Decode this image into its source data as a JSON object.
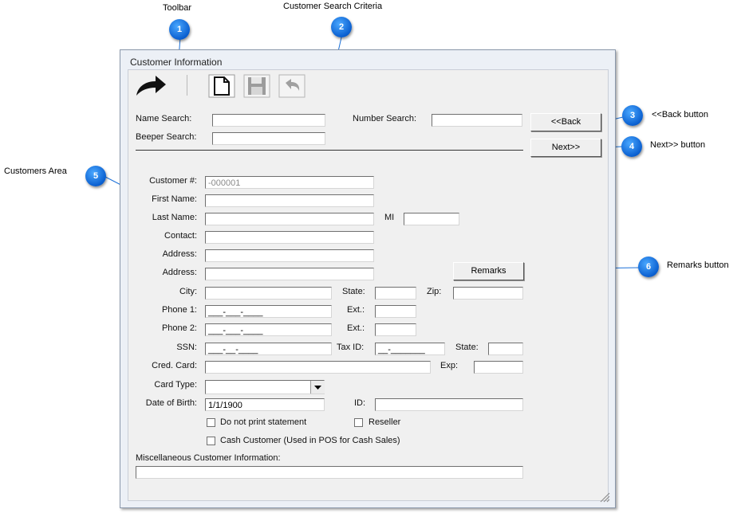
{
  "annotations": {
    "toolbar": "Toolbar",
    "customer_search_criteria": "Customer Search Criteria",
    "back_button": "<<Back button",
    "next_button": "Next>> button",
    "customers_area": "Customers Area",
    "remarks_button": "Remarks button",
    "bubbles": [
      "1",
      "2",
      "3",
      "4",
      "5",
      "6"
    ]
  },
  "window": {
    "title": "Customer Information"
  },
  "toolbar": {
    "icons": [
      "redo-arrow-icon",
      "new-document-icon",
      "save-icon",
      "undo-icon"
    ]
  },
  "search": {
    "name_label": "Name Search:",
    "number_label": "Number Search:",
    "beeper_label": "Beeper Search:",
    "name_value": "",
    "number_value": "",
    "beeper_value": "",
    "back_label": "<<Back",
    "next_label": "Next>>"
  },
  "customer": {
    "customer_no_label": "Customer #:",
    "customer_no_value": "-000001",
    "first_name_label": "First Name:",
    "last_name_label": "Last Name:",
    "mi_label": "MI",
    "contact_label": "Contact:",
    "address1_label": "Address:",
    "address2_label": "Address:",
    "remarks_label": "Remarks",
    "city_label": "City:",
    "state_label": "State:",
    "zip_label": "Zip:",
    "phone1_label": "Phone 1:",
    "phone1_value": "___-___-____",
    "ext1_label": "Ext.:",
    "phone2_label": "Phone 2:",
    "phone2_value": "___-___-____",
    "ext2_label": "Ext.:",
    "ssn_label": "SSN:",
    "ssn_value": "___-__-____",
    "taxid_label": "Tax ID:",
    "taxid_value": "__-_______",
    "state2_label": "State:",
    "cred_card_label": "Cred. Card:",
    "exp_label": "Exp:",
    "card_type_label": "Card Type:",
    "dob_label": "Date of Birth:",
    "dob_value": "1/1/1900",
    "id_label": "ID:",
    "do_not_print_label": "Do not print statement",
    "reseller_label": "Reseller",
    "cash_customer_label": "Cash Customer (Used in POS for Cash Sales)",
    "misc_label": "Miscellaneous Customer Information:"
  }
}
